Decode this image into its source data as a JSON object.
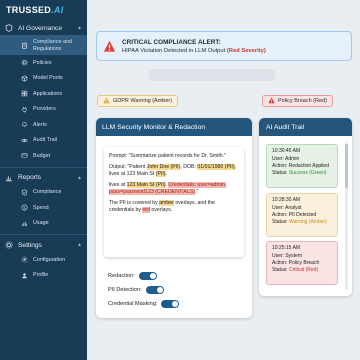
{
  "brand": {
    "name": "TRUSSED",
    "suffix": ".AI"
  },
  "sidebar": {
    "groups": [
      {
        "label": "AI Governance",
        "icon": "shield-icon",
        "items": [
          {
            "label": "Compliance and Regulations",
            "icon": "clipboard-icon",
            "active": true
          },
          {
            "label": "Policies",
            "icon": "gear-icon"
          },
          {
            "label": "Model Pools",
            "icon": "cube-icon"
          },
          {
            "label": "Applications",
            "icon": "grid-icon"
          },
          {
            "label": "Providers",
            "icon": "plug-icon"
          },
          {
            "label": "Alerts",
            "icon": "bell-icon"
          },
          {
            "label": "Audit Trail",
            "icon": "eye-icon"
          },
          {
            "label": "Budget",
            "icon": "card-icon"
          }
        ]
      },
      {
        "label": "Reports",
        "icon": "chart-icon",
        "items": [
          {
            "label": "Compliance",
            "icon": "check-shield-icon"
          },
          {
            "label": "Spend",
            "icon": "dollar-icon"
          },
          {
            "label": "Usage",
            "icon": "bar-icon"
          }
        ]
      },
      {
        "label": "Settings",
        "icon": "gear-icon",
        "items": [
          {
            "label": "Configuration",
            "icon": "cog-icon"
          },
          {
            "label": "Profile",
            "icon": "user-icon"
          }
        ]
      }
    ]
  },
  "alert": {
    "title": "CRITICAL COMPLIANCE ALERT:",
    "message": "HIPAA Violation Detected in LLM Output ",
    "severity": "(Red Severity)"
  },
  "badges": {
    "gdpr": "GDPR Warning (Amber)",
    "policy": "Policy Breach (Red)"
  },
  "llm_panel": {
    "title": "LLM Security Monitor & Redaction",
    "prompt": "Prompt: \"Summarize patient records for Dr. Smith.\"",
    "output_prefix": "Output: \"Patient ",
    "name_pii": "John Doe (PII)",
    "dob_label": ", DOB: ",
    "dob_pii": "01/01/1980 (PII)",
    "lives_label": ", lives at 123 Main St ",
    "addr_pii": "(PII)",
    "end_quote": ".",
    "line2_prefix": "lives at ",
    "line2_pii": "123 Main St (PII)",
    "line2_mid": ". ",
    "credentials": "Credentials: user=admin, pass=password123 (CREDENTIALS)",
    "line2_end": ".\"",
    "note_prefix": "The PII is covered by ",
    "note_amber": "amber",
    "note_mid": " overlays, and the credentials by ",
    "note_red": "red",
    "note_end": " overlays.",
    "toggles": [
      {
        "label": "Redaction:",
        "on": true
      },
      {
        "label": "PII Detection:",
        "on": true
      },
      {
        "label": "Credential Masking:",
        "on": true
      }
    ]
  },
  "audit": {
    "title": "AI Audit Trail",
    "entries": [
      {
        "time": "10:30:45 AM",
        "user": "User: Admin",
        "action": "Action: Redaction Applied",
        "status_label": "Status: ",
        "status": "Success (Green)"
      },
      {
        "time": "10:28:30 AM",
        "user": "User: Analyst",
        "action": "Action: PII Detected",
        "status_label": "Status: ",
        "status": "Warning (Amber)"
      },
      {
        "time": "10:25:15 AM",
        "user": "User: System",
        "action": "Action: Policy Breach",
        "status_label": "Status: ",
        "status": "Critical (Red)"
      }
    ]
  },
  "colors": {
    "sidebar": "#183b56",
    "header": "#24567d",
    "amber": "#f9d98d",
    "red": "#f5b7b0",
    "toggle": "#1f5d8e"
  }
}
